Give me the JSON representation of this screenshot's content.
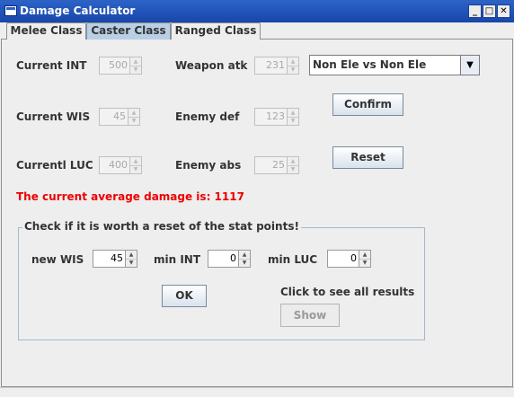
{
  "window": {
    "title": "Damage Calculator"
  },
  "tabs": [
    {
      "label": "Melee Class"
    },
    {
      "label": "Caster Class"
    },
    {
      "label": "Ranged Class"
    }
  ],
  "fields": {
    "current_int": {
      "label": "Current INT",
      "value": "500"
    },
    "current_wis": {
      "label": "Current WIS",
      "value": "45"
    },
    "current_luc": {
      "label": "Currentl LUC",
      "value": "400"
    },
    "weapon_atk": {
      "label": "Weapon atk",
      "value": "231"
    },
    "enemy_def": {
      "label": "Enemy def",
      "value": "123"
    },
    "enemy_abs": {
      "label": "Enemy abs",
      "value": "25"
    }
  },
  "element_select": {
    "value": "Non Ele vs Non Ele"
  },
  "buttons": {
    "confirm": "Confirm",
    "reset": "Reset",
    "ok": "OK",
    "show": "Show"
  },
  "result_text": "The current average damage is: 1117",
  "reset_group": {
    "title": "Check if it is worth a reset of the stat points!",
    "new_wis": {
      "label": "new WIS",
      "value": "45"
    },
    "min_int": {
      "label": "min INT",
      "value": "0"
    },
    "min_luc": {
      "label": "min LUC",
      "value": "0"
    },
    "hint": "Click to see all results"
  },
  "colors": {
    "title_bar": "#2d63c8",
    "active_tab": "#b8cfe5",
    "result": "#ee0000"
  },
  "icons": {
    "minimize": "minimize-icon",
    "maximize": "maximize-icon",
    "close": "close-icon",
    "dropdown": "chevron-down-icon",
    "spin_up": "spin-up-icon",
    "spin_down": "spin-down-icon"
  }
}
